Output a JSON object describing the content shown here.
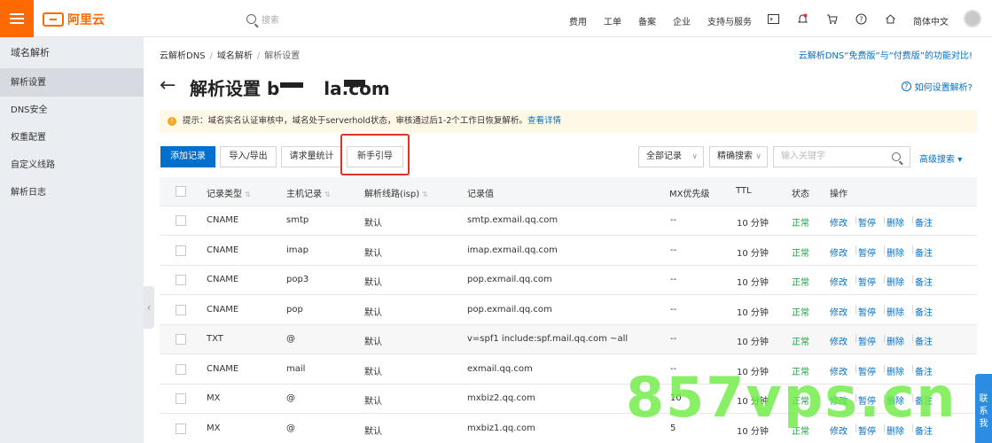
{
  "topnav": {
    "brand": "阿里云",
    "search_placeholder": "搜索",
    "links": [
      "费用",
      "工单",
      "备案",
      "企业",
      "支持与服务"
    ],
    "language": "简体中文"
  },
  "sidebar": {
    "title": "域名解析",
    "items": [
      "解析设置",
      "DNS安全",
      "权重配置",
      "自定义线路",
      "解析日志"
    ],
    "active": "解析设置"
  },
  "breadcrumb": [
    "云解析DNS",
    "域名解析",
    "解析设置"
  ],
  "compare_link": "云解析DNS“免费版”与“付费版”的功能对比!",
  "page": {
    "title_prefix": "解析设置 b",
    "title_mid": "l",
    "title_suffix": "a.com",
    "help": "如何设置解析?"
  },
  "notice": {
    "text": "提示：域名实名认证审核中，域名处于serverhold状态，审核通过后1-2个工作日恢复解析。",
    "link": "查看详情"
  },
  "toolbar": {
    "add": "添加记录",
    "import_export": "导入/导出",
    "stats": "请求量统计",
    "guide": "新手引导",
    "filter_all": "全部记录",
    "precise": "精确搜索",
    "keyword_placeholder": "输入关键字",
    "advanced": "高级搜索"
  },
  "table": {
    "headers": [
      "记录类型",
      "主机记录",
      "解析线路(isp)",
      "记录值",
      "MX优先级",
      "TTL",
      "状态",
      "操作"
    ],
    "actions": [
      "修改",
      "暂停",
      "删除",
      "备注"
    ],
    "rows": [
      {
        "type": "CNAME",
        "host": "smtp",
        "line": "默认",
        "value": "smtp.exmail.qq.com",
        "mx": "--",
        "ttl": "10 分钟",
        "status": "正常"
      },
      {
        "type": "CNAME",
        "host": "imap",
        "line": "默认",
        "value": "imap.exmail.qq.com",
        "mx": "--",
        "ttl": "10 分钟",
        "status": "正常"
      },
      {
        "type": "CNAME",
        "host": "pop3",
        "line": "默认",
        "value": "pop.exmail.qq.com",
        "mx": "--",
        "ttl": "10 分钟",
        "status": "正常"
      },
      {
        "type": "CNAME",
        "host": "pop",
        "line": "默认",
        "value": "pop.exmail.qq.com",
        "mx": "--",
        "ttl": "10 分钟",
        "status": "正常"
      },
      {
        "type": "TXT",
        "host": "@",
        "line": "默认",
        "value": "v=spf1 include:spf.mail.qq.com ~all",
        "mx": "--",
        "ttl": "10 分钟",
        "status": "正常"
      },
      {
        "type": "CNAME",
        "host": "mail",
        "line": "默认",
        "value": "exmail.qq.com",
        "mx": "--",
        "ttl": "10 分钟",
        "status": "正常"
      },
      {
        "type": "MX",
        "host": "@",
        "line": "默认",
        "value": "mxbiz2.qq.com",
        "mx": "10",
        "ttl": "10 分钟",
        "status": "正常"
      },
      {
        "type": "MX",
        "host": "@",
        "line": "默认",
        "value": "mxbiz1.qq.com",
        "mx": "5",
        "ttl": "10 分钟",
        "status": "正常"
      }
    ]
  },
  "watermark": "857vps.cn",
  "side_tab": "联系我"
}
